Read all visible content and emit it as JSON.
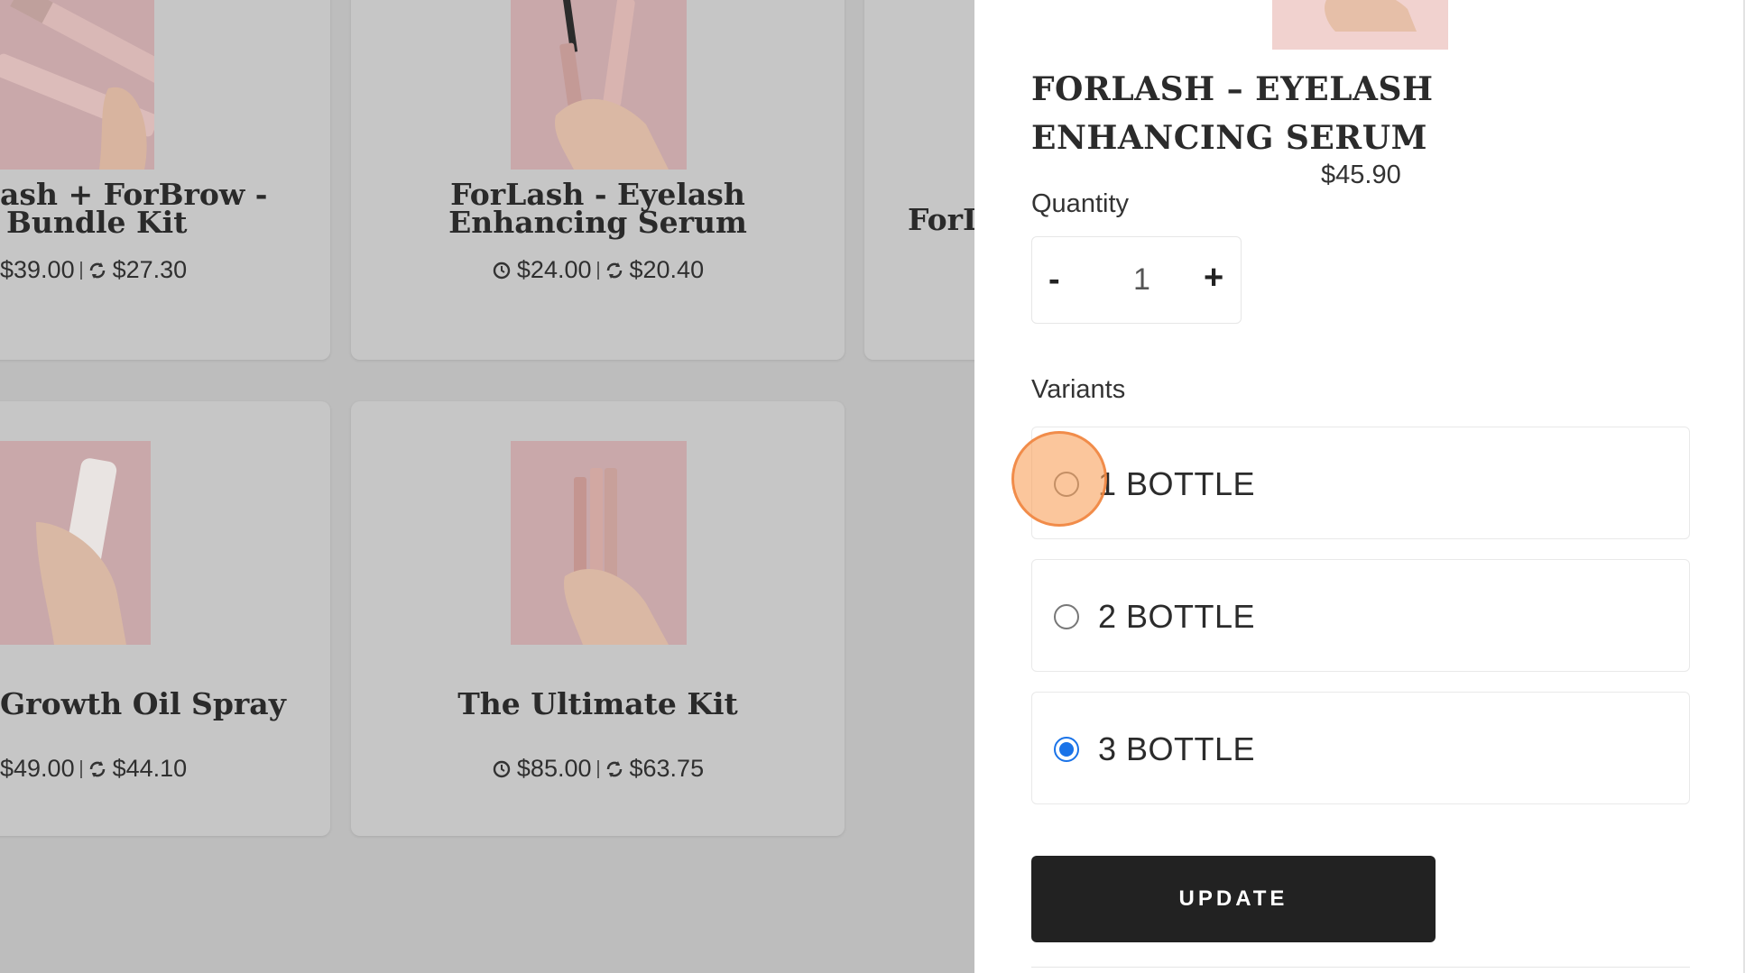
{
  "product_grid": {
    "cards": [
      {
        "title_lines": [
          "ash + ForBrow -",
          "Bundle Kit"
        ],
        "price_regular": "$39.00",
        "price_subscribe": "$27.30"
      },
      {
        "title_lines": [
          "ForLash - Eyelash",
          "Enhancing Serum"
        ],
        "price_regular": "$24.00",
        "price_subscribe": "$20.40"
      },
      {
        "title_lines": [
          "ForL"
        ]
      },
      {
        "title_lines": [
          "Growth Oil Spray"
        ],
        "price_regular": "$49.00",
        "price_subscribe": "$44.10"
      },
      {
        "title_lines": [
          "The Ultimate Kit"
        ],
        "price_regular": "$85.00",
        "price_subscribe": "$63.75"
      }
    ]
  },
  "drawer": {
    "product_title": "FORLASH – EYELASH ENHANCING SERUM",
    "price": "$45.90",
    "quantity_label": "Quantity",
    "quantity_minus": "-",
    "quantity_value": "1",
    "quantity_plus": "+",
    "variants_label": "Variants",
    "variants": [
      {
        "label": "1 BOTTLE",
        "checked": false
      },
      {
        "label": "2 BOTTLE",
        "checked": false
      },
      {
        "label": "3 BOTTLE",
        "checked": true
      }
    ],
    "update_label": "UPDATE"
  },
  "colors": {
    "overlay_bg": "#bdbdbd",
    "radio_accent": "#1a73e8",
    "button_bg": "#222222",
    "click_indicator": "#f8a05a"
  }
}
